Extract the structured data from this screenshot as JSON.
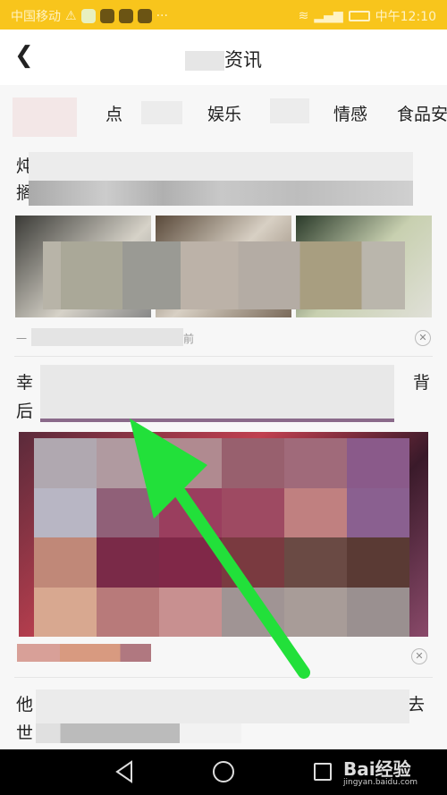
{
  "status_bar": {
    "carrier": "中国移动",
    "time": "中午12:10",
    "bg": "#f8c51c"
  },
  "header": {
    "title": "资讯",
    "back_icon": "chevron-left-icon"
  },
  "tabs": [
    {
      "label": "点"
    },
    {
      "label": "娱乐"
    },
    {
      "label": "情感"
    },
    {
      "label": "食品安"
    }
  ],
  "articles": [
    {
      "title_start": "炖",
      "title_line2_start": "搁",
      "meta_start": "一",
      "meta_end": "前"
    },
    {
      "title_start": "幸",
      "title_end": "背",
      "title_line2_start": "后"
    },
    {
      "title_start": "他",
      "title_end": "去",
      "title_line2_start": "世"
    }
  ],
  "nav": {
    "back_icon": "triangle-back-icon",
    "home_icon": "circle-home-icon",
    "recent_icon": "square-recent-icon"
  },
  "watermark": {
    "brand": "Bai经验",
    "url": "jingyan.baidu.com"
  },
  "arrow_color": "#22e03a"
}
